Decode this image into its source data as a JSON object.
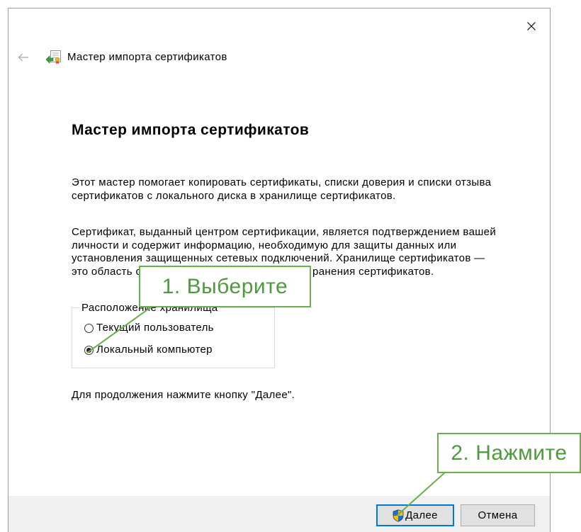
{
  "window": {
    "title": "Мастер импорта сертификатов",
    "app_icon": "certificate-wizard-icon",
    "back_button": {
      "icon": "back-arrow-icon",
      "enabled": false
    },
    "close_button": {
      "icon": "close-icon"
    }
  },
  "content": {
    "heading": "Мастер импорта сертификатов",
    "intro": [
      "Этот мастер помогает копировать сертификаты, списки доверия и списки отзыва",
      "сертификатов с локального диска в хранилище сертификатов."
    ],
    "description": [
      "Сертификат, выданный центром сертификации, является подтверждением вашей",
      "личности и содержит информацию, необходимую для защиты данных или",
      "установления защищенных сетевых подключений. Хранилище сертификатов —"
    ],
    "description_last_line": {
      "visible_start": "это область с",
      "visible_end": "ранения сертификатов."
    },
    "store_location": {
      "label": "Расположение хранилища",
      "options": [
        {
          "label": "Текущий пользователь",
          "selected": false
        },
        {
          "label": "Локальный компьютер",
          "selected": true
        }
      ]
    },
    "hint": "Для продолжения нажмите кнопку \"Далее\"."
  },
  "footer": {
    "next_button": {
      "label": "Далее",
      "icon": "uac-shield-icon",
      "is_default": true
    },
    "cancel_button": {
      "label": "Отмена"
    }
  },
  "annotations": [
    {
      "label": "1. Выберите"
    },
    {
      "label": "2. Нажмите"
    }
  ],
  "colors": {
    "accent": "#0078d7",
    "annotation_border": "#6ab04c",
    "annotation_text": "#4e9a3c",
    "footer_background": "#f0f0f0"
  }
}
